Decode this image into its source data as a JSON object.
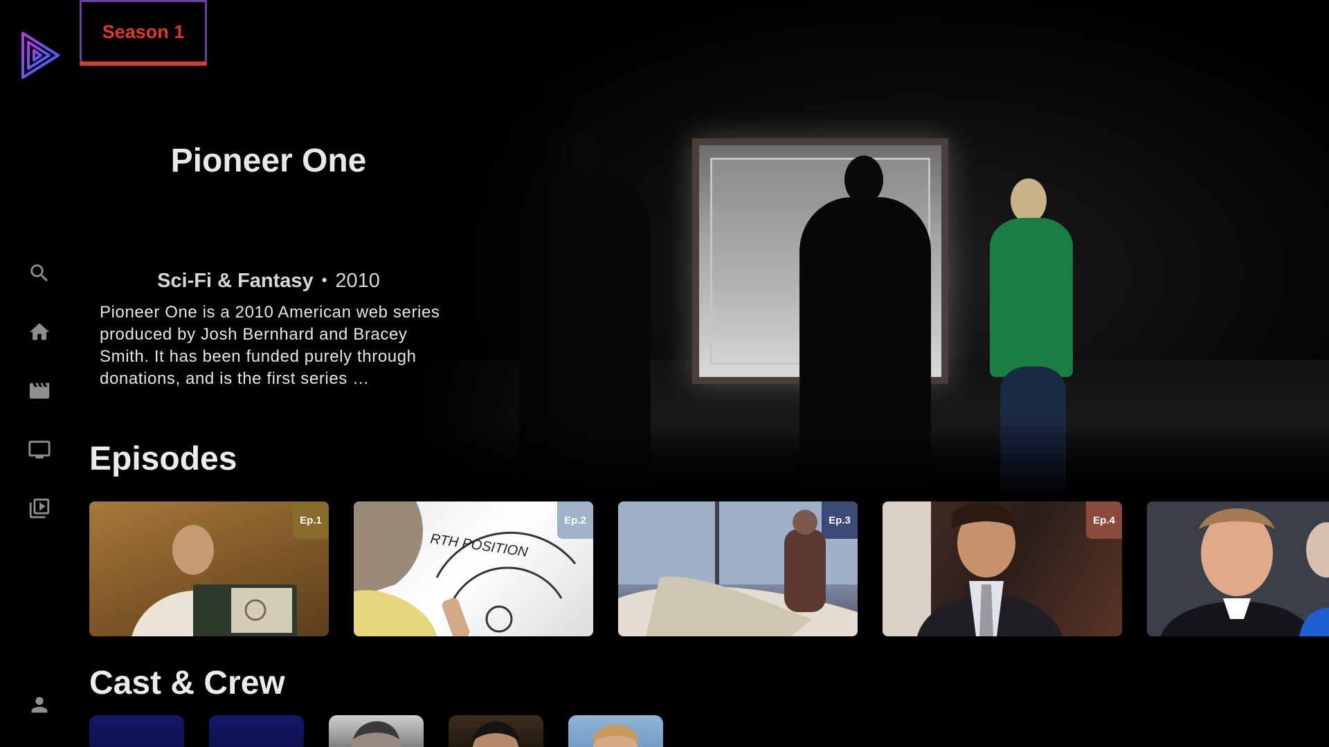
{
  "app": {
    "logo": "play-logo-icon"
  },
  "sidebar": {
    "items": [
      {
        "icon": "search-icon"
      },
      {
        "icon": "home-icon"
      },
      {
        "icon": "movies-icon"
      },
      {
        "icon": "tv-icon"
      },
      {
        "icon": "library-icon"
      }
    ],
    "profile_icon": "person-icon"
  },
  "season_tab": {
    "label": "Season 1"
  },
  "show": {
    "title": "Pioneer One",
    "genre": "Sci-Fi & Fantasy",
    "separator": "•",
    "year": "2010",
    "overview": "Pioneer One is a 2010 American web series produced by Josh Bernhard and Bracey Smith. It has been funded purely through donations, and is the first series …"
  },
  "episodes": {
    "heading": "Episodes",
    "items": [
      {
        "badge": "Ep.1",
        "badge_color": "#8a6a28"
      },
      {
        "badge": "Ep.2",
        "badge_color": "#9fb2c8"
      },
      {
        "badge": "Ep.3",
        "badge_color": "#3c4a7a"
      },
      {
        "badge": "Ep.4",
        "badge_color": "#8a4a3c"
      },
      {
        "badge": ""
      }
    ]
  },
  "cast": {
    "heading": "Cast & Crew"
  },
  "colors": {
    "accent": "#e03a2f",
    "tab_border": "#6a3fa0",
    "nav_icon": "#8f8f8f"
  }
}
